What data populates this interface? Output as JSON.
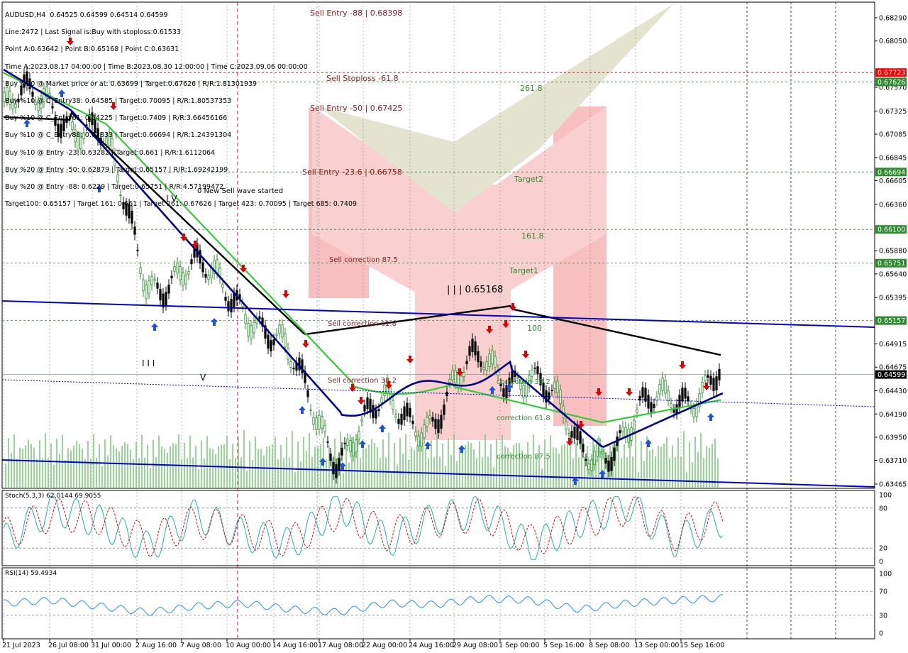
{
  "header": {
    "line1": "AUDUSD,H4  0.64525 0.64599 0.64514 0.64599",
    "line2": "Line:2472 | Last Signal is:Buy with stoploss:0.61533",
    "line3": "Point A:0.63642 | Point B:0.65168 | Point C:0.63631",
    "line4": "Time A:2023.08.17 04:00:00 | Time B:2023.08.30 12:00:00 | Time C:2023.09.06 00:00:00",
    "line5": "Buy %20 @ Market price or at: 0.63699 | Target:0.67626 | R/R:1.81301939",
    "line6": "Buy %10 @ C_Entry38: 0.64585 | Target:0.70095 | R/R:1.80537353",
    "line7": "Buy %10 @ C_Entry61: 0.64225 | Target:0.7409 | R/R:3.66456166",
    "line8": "Buy %10 @ C_Entry88: 0.63833 | Target:0.66694 | R/R:1.24391304",
    "line9": "Buy %10 @ Entry -23: 0.63282 | Target:0.661 | R/R:1.6112064",
    "line10": "Buy %20 @ Entry -50: 0.62879 | Target:0.65157 | R/R:1.69242199",
    "line11": "Buy %20 @ Entry -88: 0.6229 | Target:0.65751 | R/R:4.57199472",
    "line12": "Target100: 0.65157 | Target 161: 0.661 | Target 261: 0.67626 | Target 423: 0.70095 | Target 685: 0.7409"
  },
  "annotations": {
    "sell_entry_88": "Sell Entry -88 | 0.68398",
    "sell_stoploss": "Sell Stoploss -61.8",
    "sell_entry_50": "Sell Entry -50 | 0.67425",
    "sell_entry_23": "Sell Entry -23.6 | 0.66758",
    "sell_corr_875": "Sell correction 87.5",
    "sell_corr_618": "Sell correction 61.8",
    "sell_corr_382": "Sell correction 38.2",
    "t261": "261.8",
    "target2": "Target2",
    "t161": "161.8",
    "target1": "Target1",
    "t100": "100",
    "corr382": "correction 38.2",
    "corr618": "correction 61.8",
    "corr875": "correction 87.5",
    "wave_label": "0 New Sell wave started",
    "point_b": "| | | 0.65168",
    "wave_iv": "I V",
    "wave_iii": "I I I",
    "wave_v": "V"
  },
  "price_scale": {
    "ticks": [
      "0.68290",
      "0.68050",
      "0.67570",
      "0.67325",
      "0.67085",
      "0.66845",
      "0.66605",
      "0.66360",
      "0.65880",
      "0.65640",
      "0.65395",
      "0.64915",
      "0.64675",
      "0.64430",
      "0.64190",
      "0.63950",
      "0.63710",
      "0.63465"
    ],
    "tags": [
      {
        "text": "0.67723",
        "bg": "#ff0000",
        "fg": "#ffffff"
      },
      {
        "text": "0.67626",
        "bg": "#2e8b2e",
        "fg": "#ffffff"
      },
      {
        "text": "0.66694",
        "bg": "#2e8b2e",
        "fg": "#ffffff"
      },
      {
        "text": "0.66100",
        "bg": "#2e8b2e",
        "fg": "#ffffff"
      },
      {
        "text": "0.65751",
        "bg": "#2e8b2e",
        "fg": "#ffffff"
      },
      {
        "text": "0.65157",
        "bg": "#2e8b2e",
        "fg": "#ffffff"
      },
      {
        "text": "0.64599",
        "bg": "#000000",
        "fg": "#ffffff"
      }
    ]
  },
  "time_axis": [
    "21 Jul 2023",
    "26 Jul 08:00",
    "31 Jul 00:00",
    "2 Aug 16:00",
    "7 Aug 08:00",
    "10 Aug 00:00",
    "14 Aug 16:00",
    "17 Aug 08:00",
    "22 Aug 00:00",
    "24 Aug 16:00",
    "29 Aug 08:00",
    "1 Sep 00:00",
    "5 Sep 16:00",
    "8 Sep 08:00",
    "13 Sep 00:00",
    "15 Sep 16:00"
  ],
  "stoch": {
    "label": "Stoch(5,3,3) 62.0144 69.9055",
    "ticks": [
      "100",
      "80",
      "20",
      "0"
    ]
  },
  "rsi": {
    "label": "RSI(14) 59.4934",
    "ticks": [
      "100",
      "70",
      "30",
      "0"
    ]
  },
  "colors": {
    "bull": "#2e8b2e",
    "bear": "#000000",
    "ma_black": "#000000",
    "ma_green": "#33cc33",
    "ma_navy": "#00008b",
    "trend_blue": "#0000cc",
    "sell": "#8b1a1a",
    "target": "#2e8b2e"
  },
  "chart_data": [
    {
      "type": "line",
      "title": "AUDUSD,H4",
      "xlabel": "",
      "ylabel": "",
      "ylim": [
        0.63465,
        0.6829
      ],
      "x": [
        "21 Jul 2023",
        "26 Jul 08:00",
        "31 Jul 00:00",
        "2 Aug 16:00",
        "7 Aug 08:00",
        "10 Aug 00:00",
        "14 Aug 16:00",
        "17 Aug 08:00",
        "22 Aug 00:00",
        "24 Aug 16:00",
        "29 Aug 08:00",
        "1 Sep 00:00",
        "5 Sep 16:00",
        "8 Sep 08:00",
        "13 Sep 00:00",
        "15 Sep 16:00"
      ],
      "series": [
        {
          "values": [
            0.673,
            0.6745,
            0.6705,
            0.6565,
            0.656,
            0.6545,
            0.6465,
            0.6385,
            0.642,
            0.642,
            0.647,
            0.6465,
            0.6385,
            0.6395,
            0.644,
            0.646
          ]
        }
      ],
      "levels": [
        0.68398,
        0.67723,
        0.67626,
        0.67425,
        0.66758,
        0.66694,
        0.661,
        0.65751,
        0.65157,
        0.64599
      ],
      "grid": false
    },
    {
      "type": "line",
      "title": "Stoch(5,3,3) 62.0144 69.9055",
      "ylim": [
        0,
        100
      ],
      "x": [
        "21 Jul 2023",
        "26 Jul 08:00",
        "31 Jul 00:00",
        "2 Aug 16:00",
        "7 Aug 08:00",
        "10 Aug 00:00",
        "14 Aug 16:00",
        "17 Aug 08:00",
        "22 Aug 00:00",
        "24 Aug 16:00",
        "29 Aug 08:00",
        "1 Sep 00:00",
        "5 Sep 16:00",
        "8 Sep 08:00",
        "13 Sep 00:00",
        "15 Sep 16:00"
      ],
      "series": [
        {
          "values": [
            30,
            80,
            60,
            20,
            70,
            40,
            25,
            85,
            30,
            65,
            75,
            20,
            60,
            85,
            30,
            62
          ]
        },
        {
          "values": [
            40,
            70,
            65,
            30,
            60,
            45,
            30,
            75,
            40,
            60,
            70,
            30,
            55,
            80,
            40,
            70
          ]
        }
      ]
    },
    {
      "type": "line",
      "title": "RSI(14) 59.4934",
      "ylim": [
        0,
        100
      ],
      "x": [
        "21 Jul 2023",
        "26 Jul 08:00",
        "31 Jul 00:00",
        "2 Aug 16:00",
        "7 Aug 08:00",
        "10 Aug 00:00",
        "14 Aug 16:00",
        "17 Aug 08:00",
        "22 Aug 00:00",
        "24 Aug 16:00",
        "29 Aug 08:00",
        "1 Sep 00:00",
        "5 Sep 16:00",
        "8 Sep 08:00",
        "13 Sep 00:00",
        "15 Sep 16:00"
      ],
      "series": [
        {
          "values": [
            50,
            55,
            45,
            35,
            45,
            50,
            40,
            35,
            50,
            48,
            58,
            55,
            40,
            50,
            55,
            59
          ]
        }
      ]
    }
  ]
}
